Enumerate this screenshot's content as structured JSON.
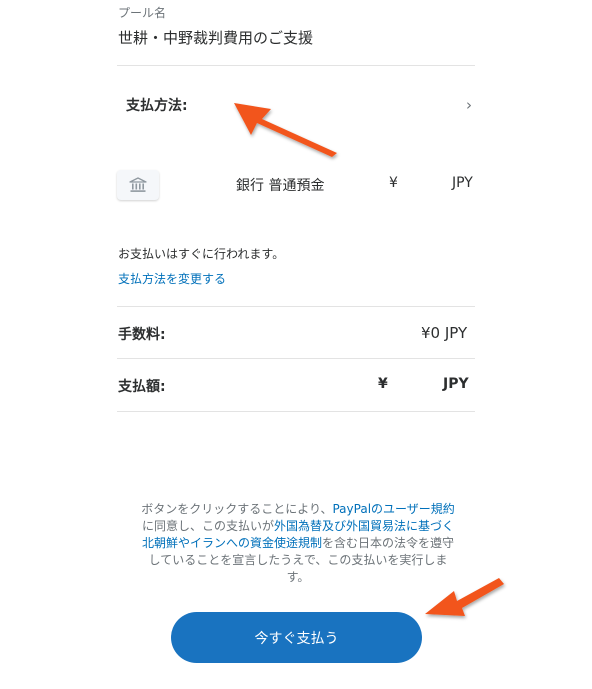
{
  "pool": {
    "label": "プール名",
    "name": "世耕・中野裁判費用のご支援"
  },
  "payment_method": {
    "label": "支払方法:",
    "chevron": "›",
    "bank_icon": "bank-icon",
    "bank_name": "銀行 普通預金",
    "yen": "¥",
    "currency": "JPY"
  },
  "instant_note": "お支払いはすぐに行われます。",
  "change_link": "支払方法を変更する",
  "fee": {
    "label": "手数料:",
    "value": "¥0 JPY"
  },
  "total": {
    "label": "支払額:",
    "yen": "¥",
    "currency": "JPY"
  },
  "legal": {
    "t1": "ボタンをクリックすることにより、",
    "l1": "PayPalのユーザー規約",
    "t2": "に同意し、この支払いが",
    "l2": "外国為替及び外国貿易法に基づく北朝鮮やイランへの資金使途規制",
    "t3": "を含む日本の法令を遵守していることを宣言したうえで、この支払いを実行します。"
  },
  "pay_button": "今すぐ支払う",
  "colors": {
    "accent": "#0070ba",
    "button": "#1973c0",
    "annotation_arrow": "#f2541b"
  }
}
